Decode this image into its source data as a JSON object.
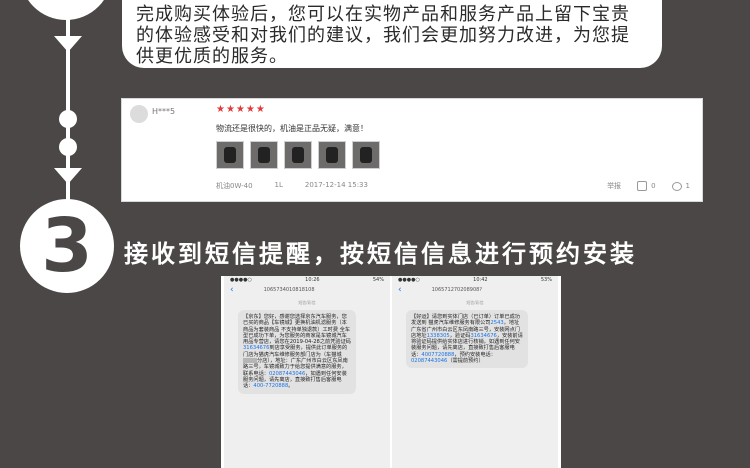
{
  "speech_text": "完成购买体验后，您可以在实物产品和服务产品上留下宝贵的体验感受和对我们的建议，我们会更加努力改进，为您提供更优质的服务。",
  "review": {
    "username": "H***5",
    "stars": "★★★★★",
    "text": "物流还是很快的，机油是正品无疑，满意！",
    "product": "机油0W-40",
    "size": "1L",
    "date": "2017-12-14 15:33",
    "report_label": "举报",
    "like_count": "0",
    "comment_count": "1"
  },
  "step3": {
    "number": "3",
    "heading": "接收到短信提醒，按短信信息进行预约安装"
  },
  "phone_left": {
    "time": "10:26",
    "battery": "54%",
    "sender": "1065734010818108",
    "stamp": "短信/彩信",
    "sms_parts": [
      "【京东】您好，感谢您选择京东汽车服务，您已买的商品【车镜城】更换机油机滤服务（本商品为套装商品 不支持单独退款）工时费 全车型已成功下单，为您服务的商家是车镜城汽车用品专营店，请您在2019-04-28之前凭验证码",
      "31634676",
      "到店享受服务，提供此订单服务的门店为猫虎汽车维修服务部门店为（车猫城",
      "分店），地址：广东广州市白云区东凤南路三号，车镜城致力于给您提供满意的服务，联系电话：",
      "02087443046",
      "，如遇到任何安装服务问题，请先离店，直接致打售后客服电话：",
      "400-7720888",
      "。"
    ]
  },
  "phone_right": {
    "time": "10:42",
    "battery": "53%",
    "sender": "106571270208908?",
    "stamp": "短信/彩信",
    "sms_parts": [
      "【好运】请您到实体门店（已订单）订单已成功发送到 猫虎汽车维修服务有限公司",
      "2543",
      "，地址广东省广州市白云区东凤南路三号，安装网点门店地址",
      "1338305",
      "，验证码",
      "31634676",
      "，安装前请将验证码提供给实体店进行核销，如遇到任何安装服务问题，请先离店，直接致打售后客服电话：",
      "4007720888",
      "，预约安装电话：",
      "02087443046",
      "（需提前预约）"
    ]
  },
  "colors": {
    "background": "#4b4746",
    "star": "#e4393c",
    "link": "#1a73e8"
  }
}
